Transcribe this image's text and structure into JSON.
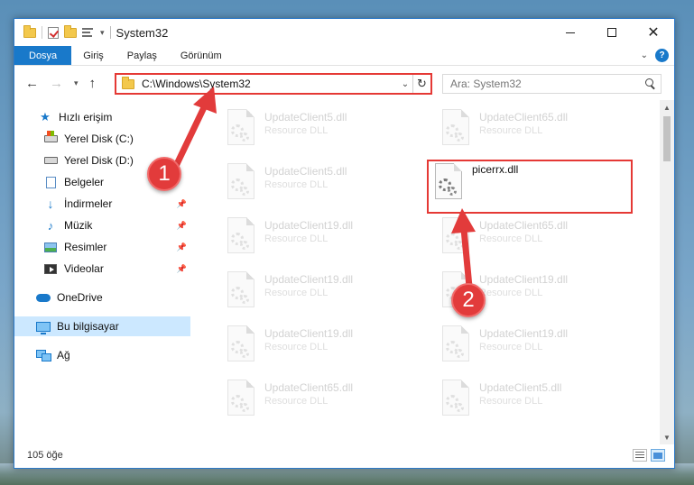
{
  "window": {
    "title": "System32"
  },
  "ribbon": {
    "tabs": [
      {
        "label": "Dosya"
      },
      {
        "label": "Giriş"
      },
      {
        "label": "Paylaş"
      },
      {
        "label": "Görünüm"
      }
    ],
    "help_label": "?"
  },
  "address": {
    "path": "C:\\Windows\\System32",
    "search_placeholder": "Ara: System32"
  },
  "nav_pane": {
    "items": [
      {
        "label": "Hızlı erişim",
        "icon": "star-icon"
      },
      {
        "label": "Yerel Disk (C:)",
        "icon": "drive-c-icon"
      },
      {
        "label": "Yerel Disk (D:)",
        "icon": "drive-d-icon"
      },
      {
        "label": "Belgeler",
        "icon": "documents-icon"
      },
      {
        "label": "İndirmeler",
        "icon": "download-icon"
      },
      {
        "label": "Müzik",
        "icon": "music-icon"
      },
      {
        "label": "Resimler",
        "icon": "pictures-icon"
      },
      {
        "label": "Videolar",
        "icon": "videos-icon"
      },
      {
        "label": "OneDrive",
        "icon": "cloud-icon"
      },
      {
        "label": "Bu bilgisayar",
        "icon": "computer-icon"
      },
      {
        "label": "Ağ",
        "icon": "network-icon"
      }
    ],
    "selected": "Bu bilgisayar"
  },
  "files": {
    "left": [
      {
        "name": "UpdateClient5.dll",
        "type": "Resource DLL"
      },
      {
        "name": "UpdateClient5.dll",
        "type": "Resource DLL"
      },
      {
        "name": "UpdateClient19.dll",
        "type": "Resource DLL"
      },
      {
        "name": "UpdateClient19.dll",
        "type": "Resource DLL"
      },
      {
        "name": "UpdateClient19.dll",
        "type": "Resource DLL"
      },
      {
        "name": "UpdateClient65.dll",
        "type": "Resource DLL"
      }
    ],
    "right": [
      {
        "name": "UpdateClient65.dll",
        "type": "Resource DLL"
      },
      {
        "name": "picerrx.dll",
        "type": ""
      },
      {
        "name": "UpdateClient65.dll",
        "type": "Resource DLL"
      },
      {
        "name": "UpdateClient19.dll",
        "type": "Resource DLL"
      },
      {
        "name": "UpdateClient19.dll",
        "type": "Resource DLL"
      },
      {
        "name": "UpdateClient5.dll",
        "type": "Resource DLL"
      }
    ]
  },
  "status": {
    "item_count": "105 öğe"
  },
  "annotations": {
    "step1": "1",
    "step2": "2",
    "color": "#e23b3b"
  }
}
